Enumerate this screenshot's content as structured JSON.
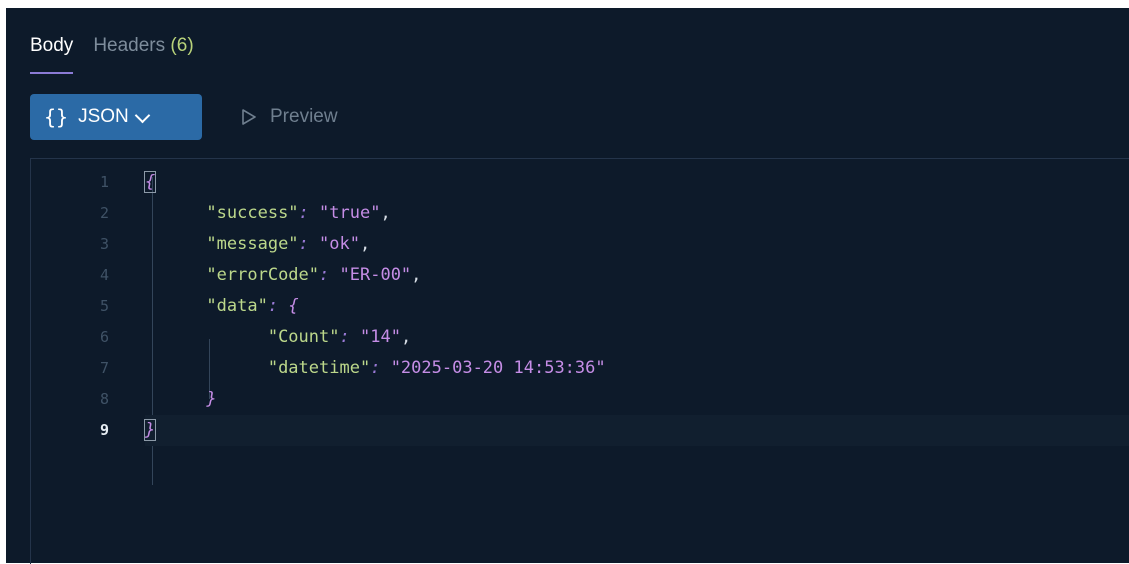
{
  "tabs": [
    {
      "label": "Body",
      "count": ""
    },
    {
      "label": "Headers",
      "count": "(6)"
    }
  ],
  "toolbar": {
    "format_icon": "{}",
    "format_label": "JSON",
    "preview_label": "Preview"
  },
  "editor": {
    "current_line": 9,
    "line_numbers": [
      "1",
      "2",
      "3",
      "4",
      "5",
      "6",
      "7",
      "8",
      "9"
    ],
    "lines": {
      "l1": {
        "open": "{"
      },
      "l2": {
        "key": "\"success\"",
        "colon": ":",
        "value": "\"true\"",
        "comma": ","
      },
      "l3": {
        "key": "\"message\"",
        "colon": ":",
        "value": "\"ok\"",
        "comma": ","
      },
      "l4": {
        "key": "\"errorCode\"",
        "colon": ":",
        "value": "\"ER-00\"",
        "comma": ","
      },
      "l5": {
        "key": "\"data\"",
        "colon": ":",
        "open": "{"
      },
      "l6": {
        "key": "\"Count\"",
        "colon": ":",
        "value": "\"14\"",
        "comma": ","
      },
      "l7": {
        "key": "\"datetime\"",
        "colon": ":",
        "value": "\"2025-03-20 14:53:36\""
      },
      "l8": {
        "close": "}"
      },
      "l9": {
        "close": "}"
      }
    }
  },
  "colors": {
    "panel_bg": "#0d1a2a",
    "accent_button": "#2b6aa6",
    "key": "#bcd88b",
    "string": "#c58de6",
    "tab_underline": "#8b7bd6"
  }
}
